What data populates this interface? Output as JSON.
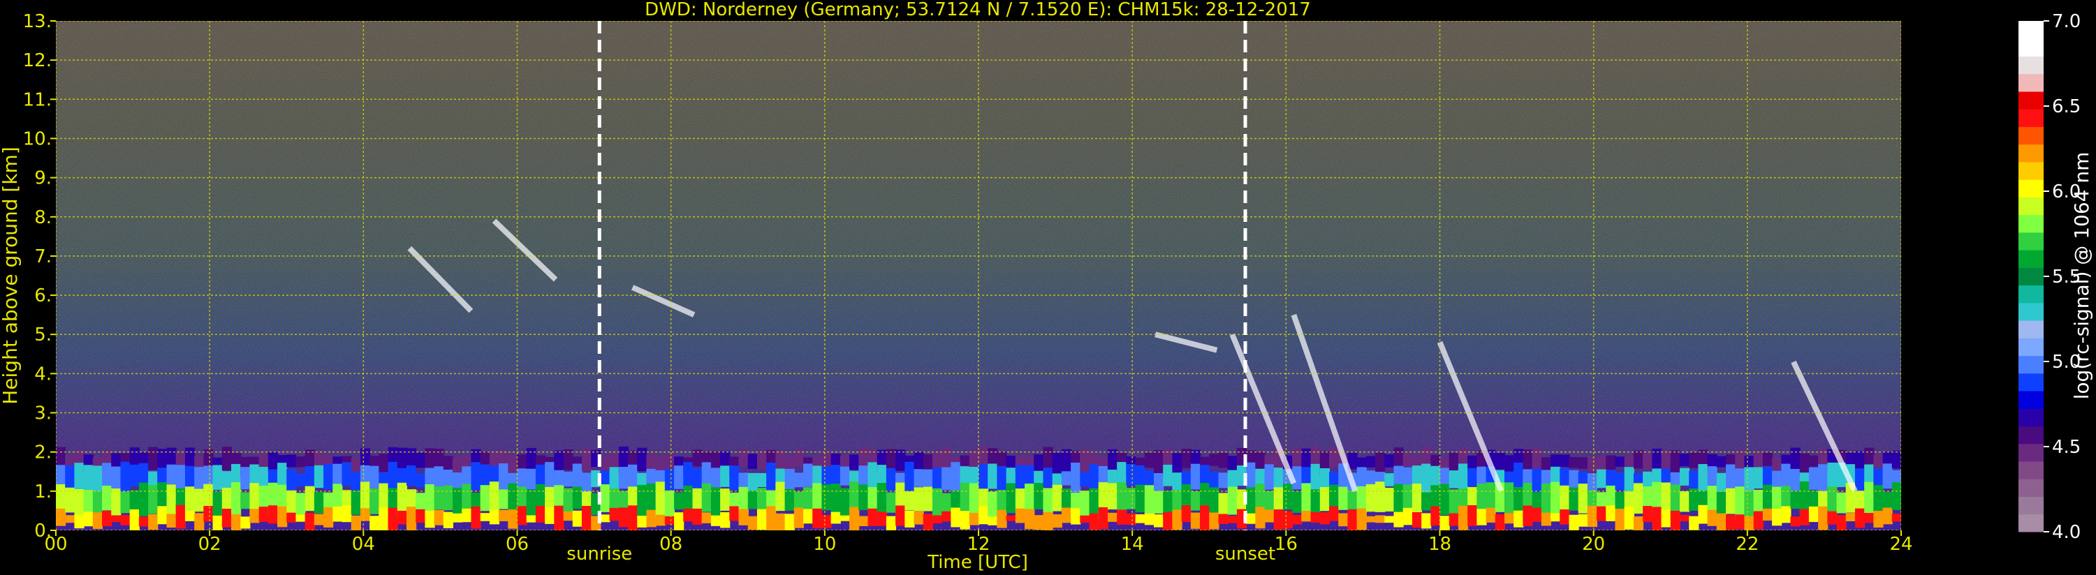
{
  "chart_data": {
    "type": "heatmap",
    "title": "DWD: Norderney (Germany; 53.7124 N / 7.1520 E):    CHM15k: 28-12-2017",
    "xlabel": "Time [UTC]",
    "ylabel": "Height above ground [km]",
    "xlim": [
      0,
      24
    ],
    "ylim": [
      0,
      13
    ],
    "x_ticks": [
      0,
      2,
      4,
      6,
      8,
      10,
      12,
      14,
      16,
      18,
      20,
      22,
      24
    ],
    "x_tick_labels": [
      "00",
      "02",
      "04",
      "06",
      "08",
      "10",
      "12",
      "14",
      "16",
      "18",
      "20",
      "22",
      "24"
    ],
    "y_ticks": [
      0,
      1,
      2,
      3,
      4,
      5,
      6,
      7,
      8,
      9,
      10,
      11,
      12,
      13
    ],
    "y_tick_labels": [
      "0.",
      "1.",
      "2.",
      "3.",
      "4.",
      "5.",
      "6.",
      "7.",
      "8.",
      "9.",
      "10.",
      "11.",
      "12.",
      "13."
    ],
    "grid": true,
    "grid_color": "#d8d800",
    "events": [
      {
        "label": "sunrise",
        "time": 7.07
      },
      {
        "label": "sunset",
        "time": 15.47
      }
    ],
    "colorbar": {
      "label": "log(rc-signal) @ 1064 nm",
      "range": [
        4.0,
        7.0
      ],
      "ticks": [
        4.0,
        4.5,
        5.0,
        5.5,
        6.0,
        6.5,
        7.0
      ],
      "tick_labels": [
        "4.0",
        "4.5",
        "5.0",
        "5.5",
        "6.0",
        "6.5",
        "7.0"
      ],
      "colors": [
        "#a88ca8",
        "#9a7a9a",
        "#8e6090",
        "#804a86",
        "#6a2a80",
        "#4a0a80",
        "#2a00a8",
        "#0000e0",
        "#1040ff",
        "#4a80ff",
        "#7ca8ff",
        "#a0b8f0",
        "#30c8d0",
        "#10b8a0",
        "#008840",
        "#00a830",
        "#30d040",
        "#80ff40",
        "#c8ff20",
        "#ffff00",
        "#ffcc00",
        "#ff9900",
        "#ff5500",
        "#ff1010",
        "#e80000",
        "#f0b8b8",
        "#e8e0e0",
        "#ffffff",
        "#ffffff"
      ]
    }
  }
}
